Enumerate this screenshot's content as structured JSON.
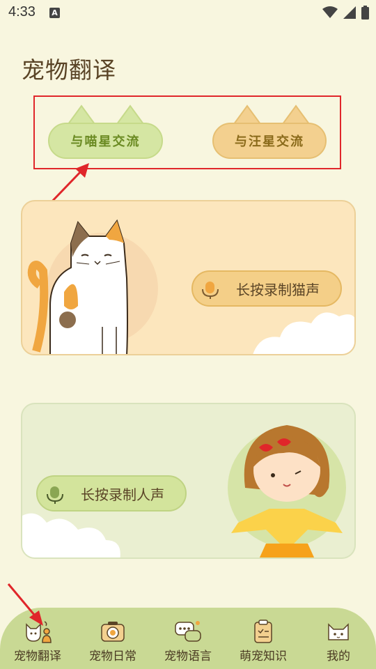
{
  "status_bar": {
    "time": "4:33",
    "notification_label": "A"
  },
  "page": {
    "title": "宠物翻译"
  },
  "modes": [
    {
      "label": "与喵星交流",
      "color": "#d5e6a3"
    },
    {
      "label": "与汪星交流",
      "color": "#f3d08f"
    }
  ],
  "cat_card": {
    "record_label": "长按录制猫声"
  },
  "human_card": {
    "record_label": "长按录制人声"
  },
  "bottom_nav": [
    {
      "label": "宠物翻译",
      "icon": "cat-person-icon",
      "active": true
    },
    {
      "label": "宠物日常",
      "icon": "camera-icon"
    },
    {
      "label": "宠物语言",
      "icon": "chat-bubble-icon"
    },
    {
      "label": "萌宠知识",
      "icon": "clipboard-icon"
    },
    {
      "label": "我的",
      "icon": "cat-face-icon"
    }
  ],
  "colors": {
    "background": "#f8f6df",
    "highlight": "#e0262a",
    "nav": "#c9d994"
  }
}
